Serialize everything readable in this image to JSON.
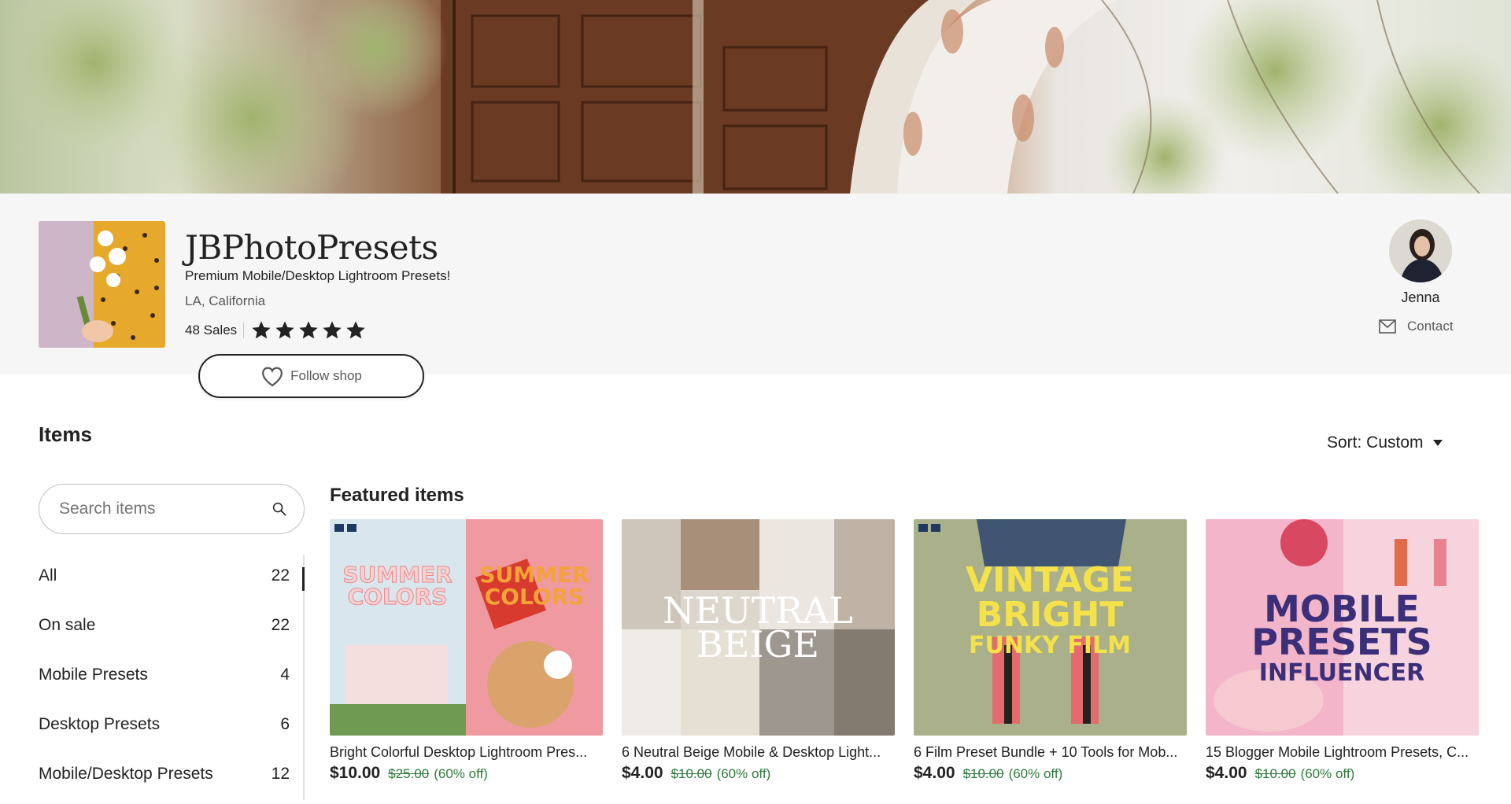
{
  "shop": {
    "name": "JBPhotoPresets",
    "tagline": "Premium Mobile/Desktop Lightroom Presets!",
    "location": "LA, California",
    "sales": "48 Sales",
    "rating_stars": 5,
    "follow_label": "Follow shop"
  },
  "owner": {
    "name": "Jenna",
    "contact_label": "Contact"
  },
  "items": {
    "title": "Items",
    "sort_label": "Sort: Custom",
    "search_placeholder": "Search items",
    "categories": [
      {
        "label": "All",
        "count": "22"
      },
      {
        "label": "On sale",
        "count": "22"
      },
      {
        "label": "Mobile Presets",
        "count": "4"
      },
      {
        "label": "Desktop Presets",
        "count": "6"
      },
      {
        "label": "Mobile/Desktop Presets",
        "count": "12"
      }
    ]
  },
  "featured": {
    "title": "Featured items",
    "cards": [
      {
        "title": "Bright Colorful Desktop Lightroom Pres...",
        "price": "$10.00",
        "old_price": "$25.00",
        "discount": "(60% off)",
        "image_text": "SUMMER COLORS"
      },
      {
        "title": "6 Neutral Beige Mobile & Desktop Light...",
        "price": "$4.00",
        "old_price": "$10.00",
        "discount": "(60% off)",
        "image_text": "NEUTRAL BEIGE"
      },
      {
        "title": "6 Film Preset Bundle + 10 Tools for Mob...",
        "price": "$4.00",
        "old_price": "$10.00",
        "discount": "(60% off)",
        "image_text": "VINTAGE BRIGHT FUNKY FILM"
      },
      {
        "title": "15 Blogger Mobile Lightroom Presets, C...",
        "price": "$4.00",
        "old_price": "$10.00",
        "discount": "(60% off)",
        "image_text": "MOBILE PRESETS INFLUENCER"
      }
    ]
  },
  "colors": {
    "sale_green": "#2f7a3c",
    "header_bg": "#f6f6f6",
    "text": "#222222"
  }
}
